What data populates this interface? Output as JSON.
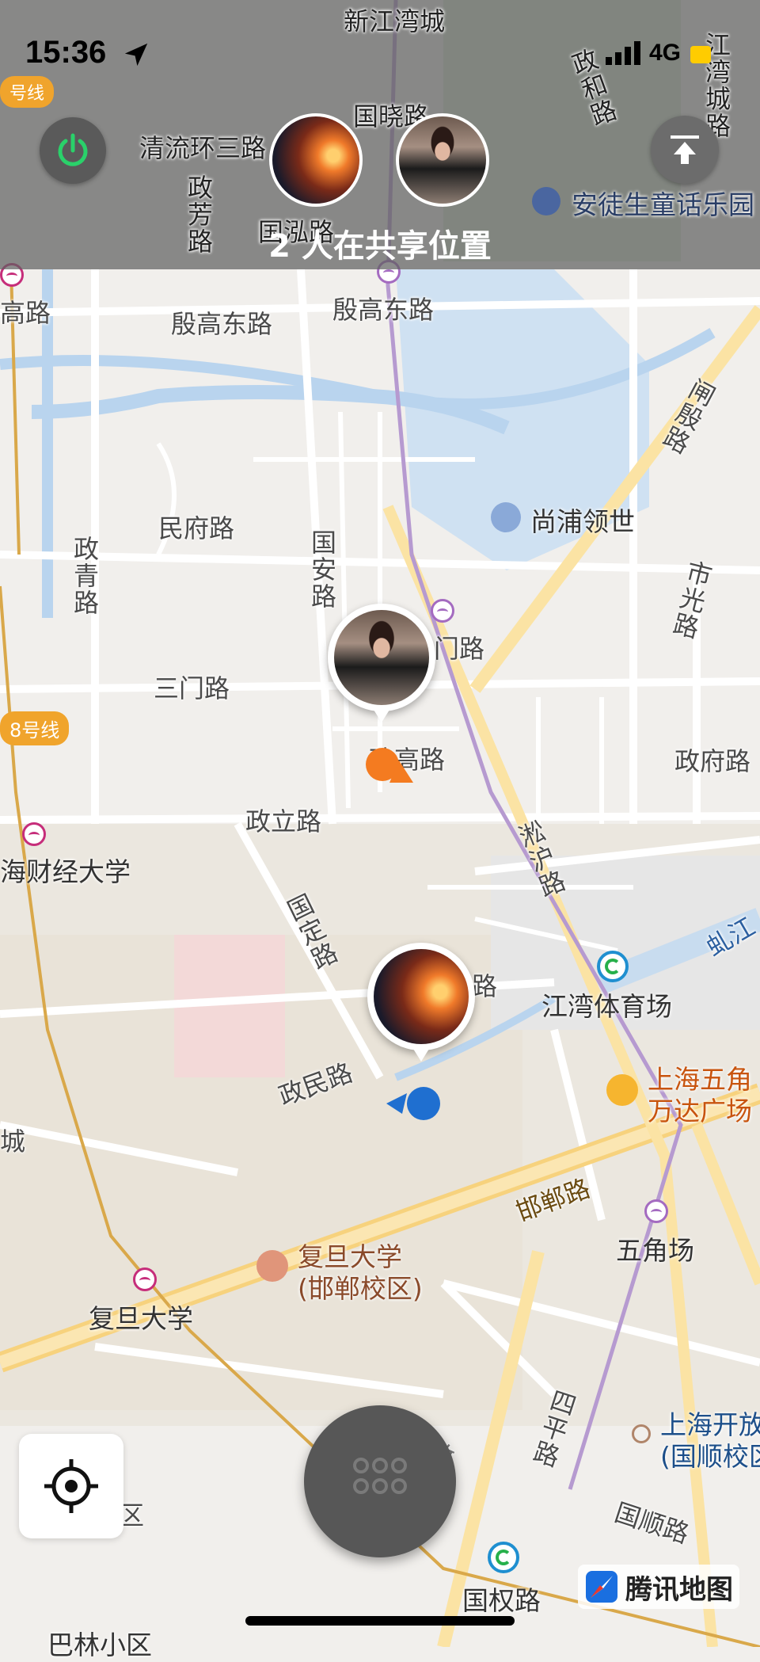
{
  "status_bar": {
    "time": "15:36",
    "network": "4G"
  },
  "header": {
    "share_text": "2 人在共享位置",
    "top_road_labels": [
      "新江湾城",
      "国晓路",
      "清流环三路",
      "政芳路",
      "国泓路",
      "政和路",
      "江湾城路",
      "号线"
    ],
    "top_poi": "安徒生童话乐园"
  },
  "map": {
    "road_labels": {
      "yingao_east_1": "殷高东路",
      "yingao_east_2": "殷高东路",
      "yingao_west": "高路",
      "minfu": "民府路",
      "zhengqing": "政青路",
      "guoan": "国安路",
      "sanmen": "三门路",
      "sanmen2": "门路",
      "zhenggao": "政高路",
      "zhengfu": "政府路",
      "zhengli": "政立路",
      "songhu": "淞沪路",
      "guoding": "国定路",
      "zhengmin": "政民路",
      "handan": "邯郸路",
      "sping": "四平路",
      "guoshun": "国顺路",
      "shiguang": "市光路",
      "zhayin": "闸殷路",
      "luling": "路",
      "hongjiang": "虬江",
      "zheng_vertical": "政",
      "cheng": "城",
      "qu": "区"
    },
    "pois": {
      "shangpu": "尚浦领世",
      "jiangwan_stadium": "江湾体育场",
      "wanda_1": "上海五角",
      "wanda_2": "万达广场",
      "wujiaochang": "五角场",
      "fudan_campus_1": "复旦大学",
      "fudan_campus_2": "(邯郸校区)",
      "fudan_station": "复旦大学",
      "kaifang_1": "上海开放",
      "kaifang_2": "(国顺校区",
      "guoquan": "国权路",
      "caijing": "海财经大学",
      "balin": "巴林小区"
    },
    "line_tags": {
      "line8": "8号线"
    }
  },
  "brand": {
    "name": "腾讯地图"
  },
  "colors": {
    "header_bg": "#606060",
    "accent_green": "#2ad16a",
    "orange_dot": "#f47b20",
    "blue_dot": "#1f6fd0"
  }
}
